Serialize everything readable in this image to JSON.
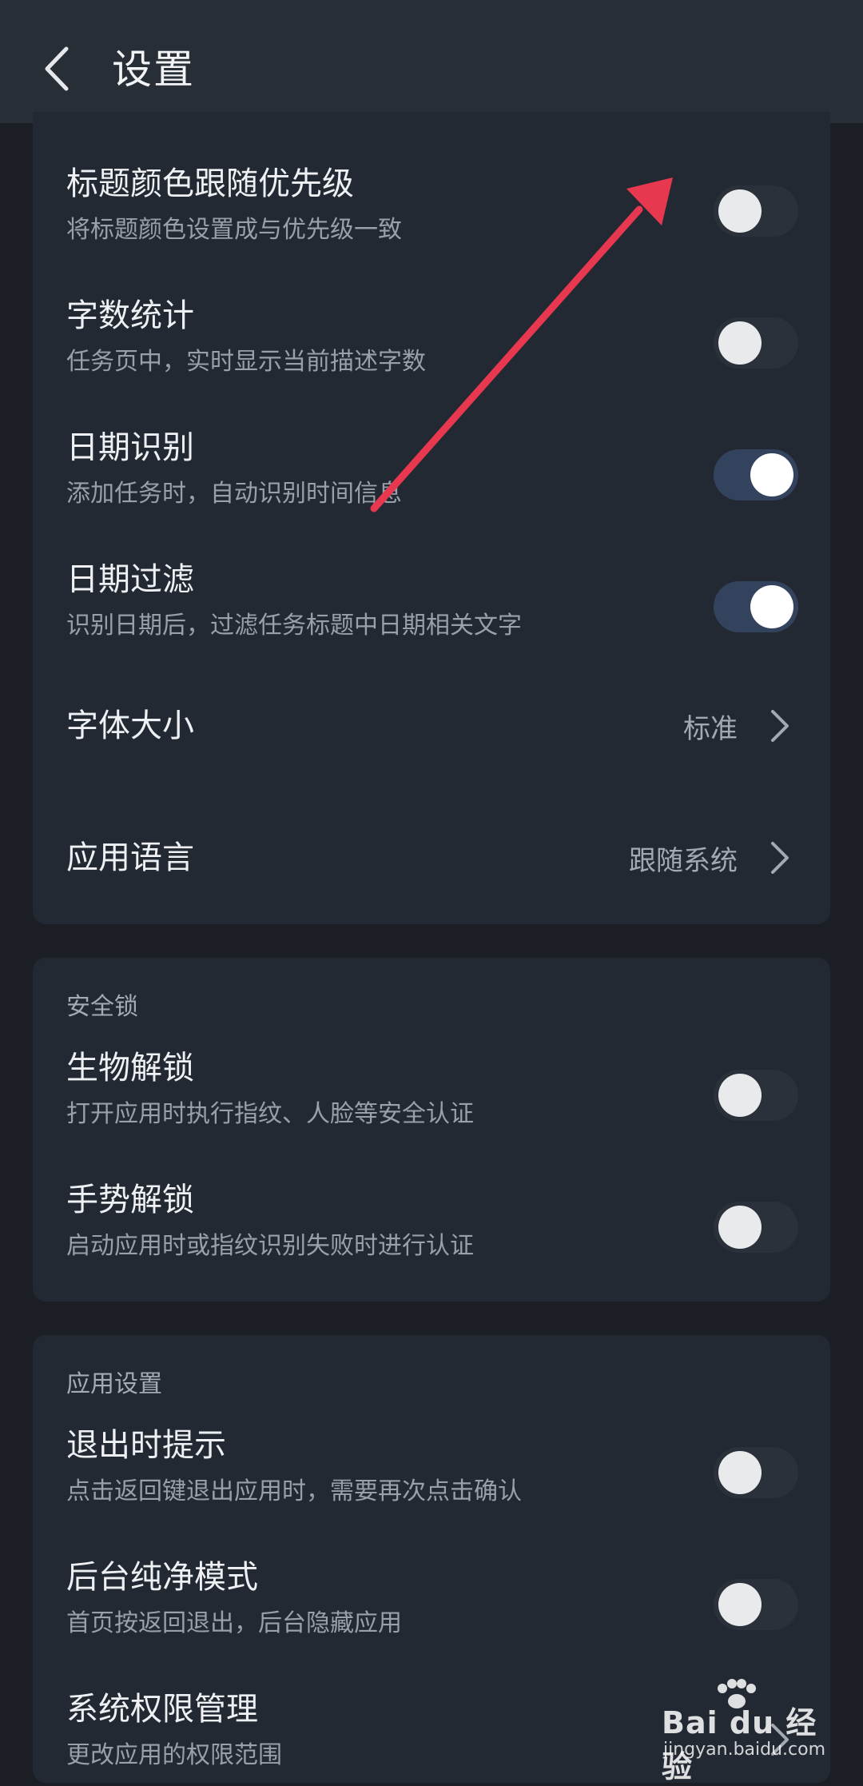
{
  "header": {
    "title": "设置"
  },
  "general": {
    "rows": [
      {
        "title": "标题颜色跟随优先级",
        "subtitle": "将标题颜色设置成与优先级一致",
        "toggle": false
      },
      {
        "title": "字数统计",
        "subtitle": "任务页中，实时显示当前描述字数",
        "toggle": false
      },
      {
        "title": "日期识别",
        "subtitle": "添加任务时，自动识别时间信息",
        "toggle": true
      },
      {
        "title": "日期过滤",
        "subtitle": "识别日期后，过滤任务标题中日期相关文字",
        "toggle": true
      }
    ],
    "font_size": {
      "title": "字体大小",
      "value": "标准"
    },
    "app_language": {
      "title": "应用语言",
      "value": "跟随系统"
    }
  },
  "security": {
    "section_title": "安全锁",
    "rows": [
      {
        "title": "生物解锁",
        "subtitle": "打开应用时执行指纹、人脸等安全认证",
        "toggle": false
      },
      {
        "title": "手势解锁",
        "subtitle": "启动应用时或指纹识别失败时进行认证",
        "toggle": false
      }
    ]
  },
  "app_settings": {
    "section_title": "应用设置",
    "rows": [
      {
        "title": "退出时提示",
        "subtitle": "点击返回键退出应用时，需要再次点击确认",
        "toggle": false
      },
      {
        "title": "后台纯净模式",
        "subtitle": "首页按返回退出，后台隐藏应用",
        "toggle": false
      },
      {
        "title": "系统权限管理",
        "subtitle": "更改应用的权限范围"
      }
    ]
  },
  "annotation": {
    "arrow_color": "#e8384f"
  },
  "watermark": {
    "brand": "Bai du 经验",
    "url": "jingyan.baidu.com"
  },
  "colors": {
    "background": "#1b1f25",
    "card": "#232933",
    "toggle_on": "#34435d"
  }
}
